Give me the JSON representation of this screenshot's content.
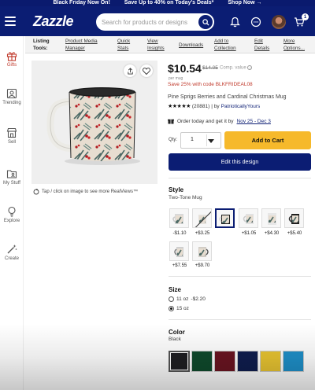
{
  "promo": [
    "Black Friday Now On!",
    "Save Up to 40% on Today's Deals*",
    "Shop Now →"
  ],
  "header": {
    "logo": "Zazzle",
    "search_placeholder": "Search for products or designs",
    "cart_count": "1"
  },
  "sidebar": {
    "items": [
      {
        "label": "Gifts"
      },
      {
        "label": "Trending"
      },
      {
        "label": "Sell"
      },
      {
        "label": "My Stuff"
      },
      {
        "label": "Explore"
      },
      {
        "label": "Create"
      }
    ]
  },
  "toolbar": {
    "label": "Listing Tools:",
    "links": [
      "Product Media Manager",
      "Quick Stats",
      "View Insights",
      "Downloads",
      "Add to Collection",
      "Edit Details",
      "More Options..."
    ]
  },
  "image": {
    "realviews_text": "Tap / click on image to see more RealViews™"
  },
  "product": {
    "price": "$10.54",
    "old_price": "$14.05",
    "price_note": "Comp. value",
    "per_item": "per mug",
    "save_text": "Save 25% with code BLKFRIDEAL08",
    "name": "Pine Sprigs Berries and Cardinal Christmas Mug",
    "stars": "★★★★★",
    "review_count": "(20881)",
    "by_label": "| by",
    "seller": "PatrioticallyYours",
    "delivery_label": "Order today and get it by",
    "delivery_dates": "Nov 25 - Dec 3",
    "qty_label": "Qty:",
    "qty_value": "1",
    "add_to_cart": "Add to Cart",
    "edit_design": "Edit this design"
  },
  "style": {
    "title": "Style",
    "selected": "Two-Tone Mug",
    "options": [
      {
        "price": "-$1.10"
      },
      {
        "price": "+$3.25"
      },
      {
        "price": ""
      },
      {
        "price": "+$1.05"
      },
      {
        "price": "+$4.30"
      },
      {
        "price": "+$5.40"
      },
      {
        "price": "+$7.55"
      },
      {
        "price": "+$9.70"
      }
    ]
  },
  "size": {
    "title": "Size",
    "options": [
      {
        "label": "11 oz",
        "delta": "-$2.20"
      },
      {
        "label": "15 oz",
        "delta": ""
      }
    ]
  },
  "color": {
    "title": "Color",
    "selected": "Black",
    "swatches": [
      "#1e1e22",
      "#0f4a2c",
      "#6a1421",
      "#0f1d4e",
      "#e8c431",
      "#1e8fc8"
    ]
  }
}
